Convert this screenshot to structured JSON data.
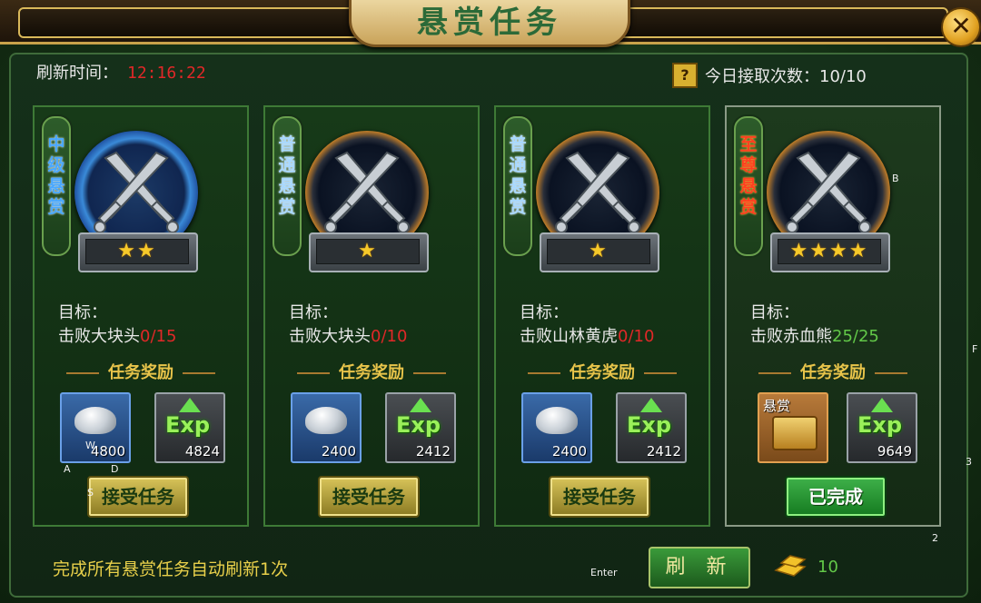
{
  "window": {
    "title": "悬赏任务",
    "close_label": "✕"
  },
  "header": {
    "refresh_label": "刷新时间：",
    "refresh_time": "12:16:22",
    "help_label": "?",
    "daily_label": "今日接取次数：10/10"
  },
  "cards": [
    {
      "tier_label": "中级悬赏",
      "tier_color": "#4aa8ff",
      "stars": "★★",
      "goal_label": "目标：",
      "goal_target": "击败大块头",
      "goal_progress": "0/15",
      "reward_title": "任务奖励",
      "silver_qty": "4800",
      "exp_qty": "4824",
      "action": "接受任务"
    },
    {
      "tier_label": "普通悬赏",
      "tier_color": "#a8d8ff",
      "stars": "★",
      "goal_label": "目标：",
      "goal_target": "击败大块头",
      "goal_progress": "0/10",
      "reward_title": "任务奖励",
      "silver_qty": "2400",
      "exp_qty": "2412",
      "action": "接受任务"
    },
    {
      "tier_label": "普通悬赏",
      "tier_color": "#a8d8ff",
      "stars": "★",
      "goal_label": "目标：",
      "goal_target": "击败山林黄虎",
      "goal_progress": "0/10",
      "reward_title": "任务奖励",
      "silver_qty": "2400",
      "exp_qty": "2412",
      "action": "接受任务"
    },
    {
      "tier_label": "至尊悬赏",
      "tier_color": "#ff4020",
      "stars": "★★★★",
      "goal_label": "目标：",
      "goal_target": "击败赤血熊",
      "goal_progress": "25/25",
      "reward_title": "任务奖励",
      "chest_label": "悬赏",
      "exp_qty": "9649",
      "action": "已完成"
    }
  ],
  "footer": {
    "auto_refresh_text": "完成所有悬赏任务自动刷新1次",
    "refresh_button": "刷 新",
    "gold_count": "10"
  },
  "overlay_hints": {
    "w": "W",
    "a": "A",
    "d": "D",
    "s": "S",
    "b": "B",
    "f": "F",
    "three": "3",
    "two": "2",
    "enter": "Enter"
  },
  "colors": {
    "progress_incomplete": "#e02828",
    "progress_complete": "#62c848",
    "reward_gold": "#e8c44a"
  }
}
